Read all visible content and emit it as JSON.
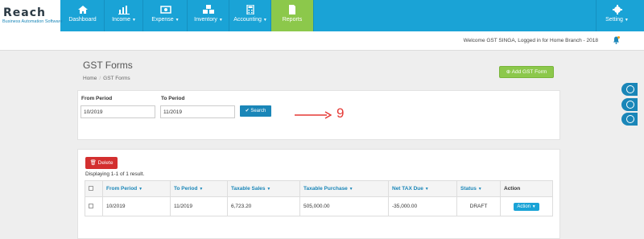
{
  "brand": {
    "logo": "Reach",
    "tagline": "Business Automation Software"
  },
  "nav": {
    "items": [
      {
        "label": "Dashboard",
        "icon": "home-icon"
      },
      {
        "label": "Income",
        "icon": "bar-chart-icon"
      },
      {
        "label": "Expense",
        "icon": "money-icon"
      },
      {
        "label": "Inventory",
        "icon": "cubes-icon"
      },
      {
        "label": "Accounting",
        "icon": "calculator-icon"
      },
      {
        "label": "Reports",
        "icon": "document-icon"
      }
    ],
    "setting": "Setting"
  },
  "welcome": "Welcome GST SINGA, Logged in for Home Branch - 2018",
  "page": {
    "title": "GST Forms",
    "breadcrumb": [
      "Home",
      "GST Forms"
    ],
    "add_button": "Add GST Form"
  },
  "filter": {
    "from_label": "From Period",
    "from_value": "10/2019",
    "to_label": "To Period",
    "to_value": "11/2019",
    "search_label": "Search"
  },
  "annotation": "9",
  "list": {
    "delete_label": "Delete",
    "summary": "Displaying 1-1 of 1 result.",
    "columns": [
      "From Period",
      "To Period",
      "Taxable Sales",
      "Taxable Purchase",
      "Net TAX Due",
      "Status",
      "Action"
    ],
    "rows": [
      {
        "from": "10/2019",
        "to": "11/2019",
        "sales": "6,723.20",
        "purchase": "505,000.00",
        "net": "-35,000.00",
        "status": "DRAFT",
        "action": "Action"
      }
    ]
  },
  "colors": {
    "primary": "#1aa3d6",
    "active": "#8cc84b",
    "danger": "#d32f2f"
  }
}
